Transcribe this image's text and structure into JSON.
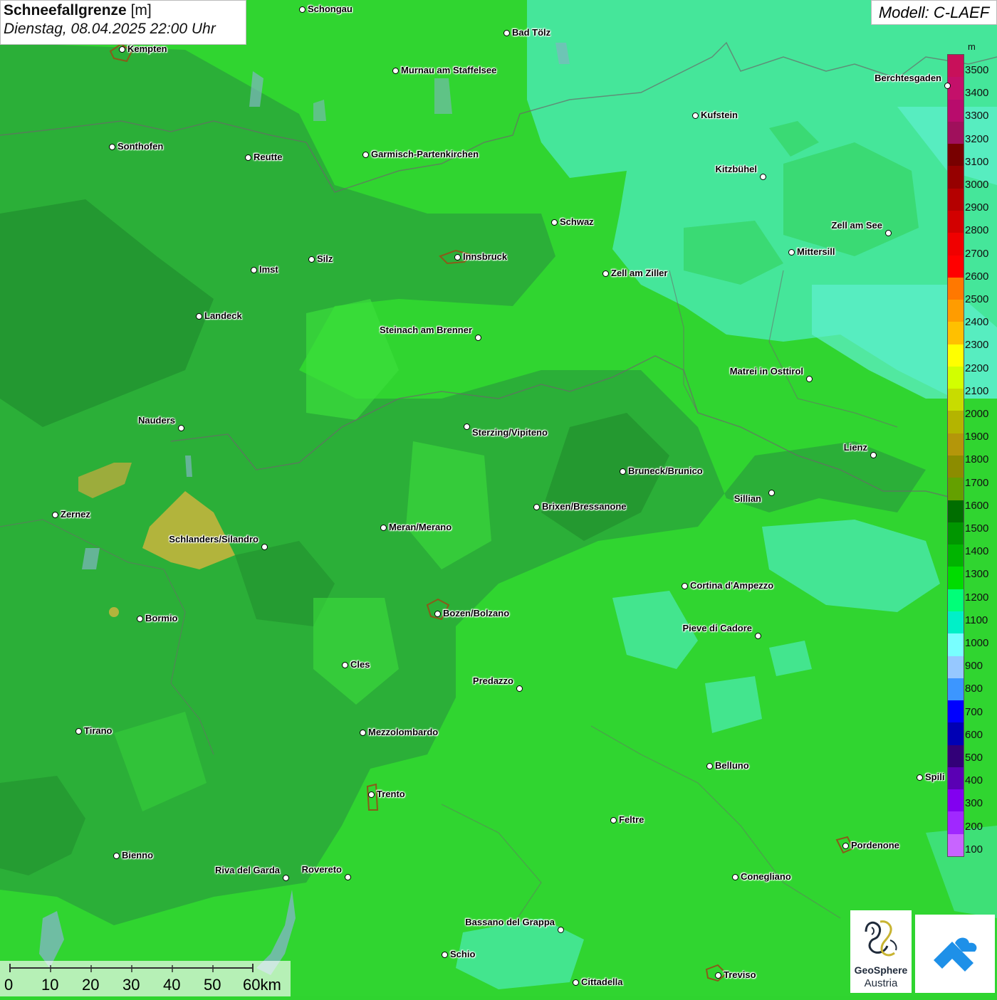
{
  "title": {
    "parameter": "Schneefallgrenze",
    "unit": "[m]",
    "datetime": "Dienstag, 08.04.2025 22:00 Uhr"
  },
  "model": "Modell: C-LAEF",
  "legend": {
    "unit": "m",
    "ticks": [
      "3500",
      "3400",
      "3300",
      "3200",
      "3100",
      "3000",
      "2900",
      "2800",
      "2700",
      "2600",
      "2500",
      "2400",
      "2300",
      "2200",
      "2100",
      "2000",
      "1900",
      "1800",
      "1700",
      "1600",
      "1500",
      "1400",
      "1300",
      "1200",
      "1100",
      "1000",
      "900",
      "800",
      "700",
      "600",
      "500",
      "400",
      "300",
      "200",
      "100"
    ],
    "colors": [
      "#c8105a",
      "#c4106a",
      "#b80c6c",
      "#a0105c",
      "#780000",
      "#960000",
      "#b40000",
      "#d20000",
      "#f00000",
      "#ff0000",
      "#ff7800",
      "#ff9c00",
      "#ffc000",
      "#ffff00",
      "#d2ff00",
      "#c8dc00",
      "#b4b400",
      "#b4960a",
      "#8c8c00",
      "#64a000",
      "#006e00",
      "#009600",
      "#00b400",
      "#00dc00",
      "#00ff78",
      "#00f0c8",
      "#78ffff",
      "#96c8ff",
      "#3c96ff",
      "#0000ff",
      "#0000b4",
      "#320078",
      "#5a00b4",
      "#8200f0",
      "#a028ff",
      "#c864ff"
    ]
  },
  "cities": [
    {
      "name": "Schongau"
    },
    {
      "name": "Bad Tölz"
    },
    {
      "name": "Kempten"
    },
    {
      "name": "Murnau am Staffelsee"
    },
    {
      "name": "Kufstein"
    },
    {
      "name": "Berchtesgaden"
    },
    {
      "name": "Sonthofen"
    },
    {
      "name": "Reutte"
    },
    {
      "name": "Garmisch-Partenkirchen"
    },
    {
      "name": "Kitzbühel"
    },
    {
      "name": "Schwaz"
    },
    {
      "name": "Zell am See"
    },
    {
      "name": "Innsbruck"
    },
    {
      "name": "Mittersill"
    },
    {
      "name": "Silz"
    },
    {
      "name": "Imst"
    },
    {
      "name": "Zell am Ziller"
    },
    {
      "name": "Landeck"
    },
    {
      "name": "Steinach am Brenner"
    },
    {
      "name": "Matrei in Osttirol"
    },
    {
      "name": "Nauders"
    },
    {
      "name": "Sterzing/Vipiteno"
    },
    {
      "name": "Lienz"
    },
    {
      "name": "Bruneck/Brunico"
    },
    {
      "name": "Sillian"
    },
    {
      "name": "Zernez"
    },
    {
      "name": "Brixen/Bressanone"
    },
    {
      "name": "Meran/Merano"
    },
    {
      "name": "Schlanders/Silandro"
    },
    {
      "name": "Cortina d'Ampezzo"
    },
    {
      "name": "Bozen/Bolzano"
    },
    {
      "name": "Bormio"
    },
    {
      "name": "Pieve di Cadore"
    },
    {
      "name": "Cles"
    },
    {
      "name": "Predazzo"
    },
    {
      "name": "Tirano"
    },
    {
      "name": "Mezzolombardo"
    },
    {
      "name": "Belluno"
    },
    {
      "name": "Trento"
    },
    {
      "name": "Feltre"
    },
    {
      "name": "Pordenone"
    },
    {
      "name": "Bienno"
    },
    {
      "name": "Riva del Garda"
    },
    {
      "name": "Rovereto"
    },
    {
      "name": "Conegliano"
    },
    {
      "name": "Bassano del Grappa"
    },
    {
      "name": "Schio"
    },
    {
      "name": "Treviso"
    },
    {
      "name": "Cittadella"
    },
    {
      "name": "Spili"
    },
    {
      "name": "Kufst"
    }
  ],
  "scalebar": {
    "labels": [
      "0",
      "10",
      "20",
      "30",
      "40",
      "50",
      "60km"
    ]
  },
  "logos": {
    "geosphere_line1": "GeoSphere",
    "geosphere_line2": "Austria"
  },
  "colors": {
    "map_base": "#2fd42f",
    "map_dark": "#2a9a35",
    "map_cyan": "#4de8b0",
    "map_yellow": "#b0b040"
  }
}
